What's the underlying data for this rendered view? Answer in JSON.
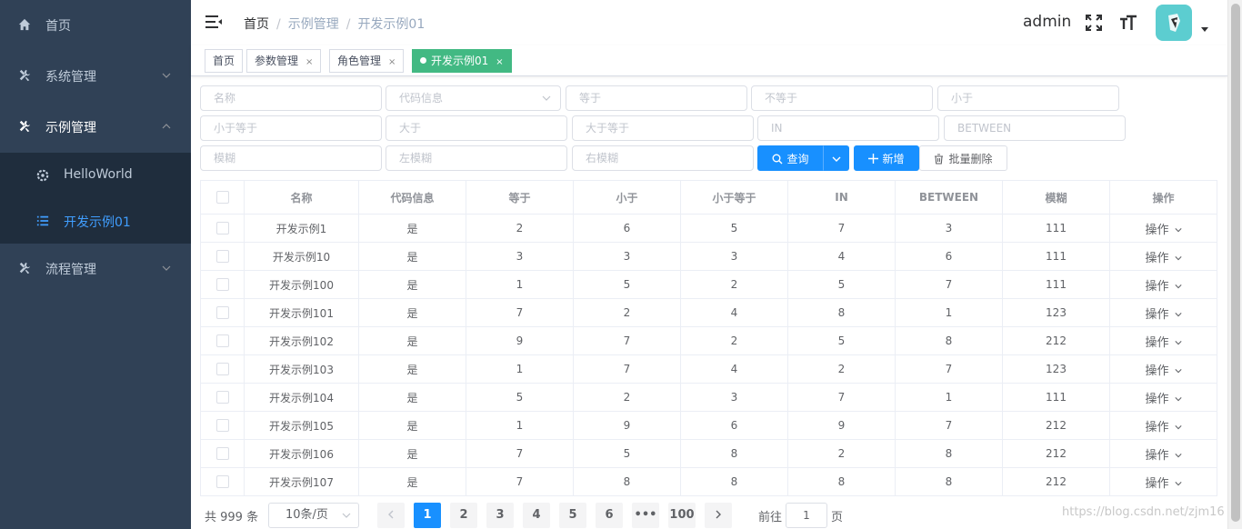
{
  "sidebar": {
    "items": [
      {
        "label": "首页",
        "icon": "home-icon"
      },
      {
        "label": "系统管理",
        "icon": "tools-icon"
      },
      {
        "label": "示例管理",
        "icon": "tools-icon"
      },
      {
        "label": "流程管理",
        "icon": "tools-icon"
      }
    ],
    "subitems": [
      {
        "label": "HelloWorld",
        "icon": "gear-icon"
      },
      {
        "label": "开发示例01",
        "icon": "list-icon"
      }
    ]
  },
  "navbar": {
    "breadcrumb": [
      "首页",
      "示例管理",
      "开发示例01"
    ],
    "breadcrumb_sep": "/",
    "username": "admin"
  },
  "tags": [
    {
      "label": "首页"
    },
    {
      "label": "参数管理",
      "close": "×"
    },
    {
      "label": "角色管理",
      "close": "×"
    },
    {
      "label": "开发示例01",
      "close": "×"
    }
  ],
  "filters": {
    "name": "名称",
    "code": "代码信息",
    "eq": "等于",
    "neq": "不等于",
    "lt": "小于",
    "lte": "小于等于",
    "gt": "大于",
    "gte": "大于等于",
    "in": "IN",
    "between": "BETWEEN",
    "like": "模糊",
    "left_like": "左模糊",
    "right_like": "右模糊"
  },
  "buttons": {
    "query": "查询",
    "add": "新增",
    "batch_delete": "批量删除"
  },
  "table": {
    "headers": [
      "名称",
      "代码信息",
      "等于",
      "小于",
      "小于等于",
      "IN",
      "BETWEEN",
      "模糊",
      "操作"
    ],
    "op_label": "操作",
    "rows": [
      [
        "开发示例1",
        "是",
        "2",
        "6",
        "5",
        "7",
        "3",
        "111"
      ],
      [
        "开发示例10",
        "是",
        "3",
        "3",
        "3",
        "4",
        "6",
        "111"
      ],
      [
        "开发示例100",
        "是",
        "1",
        "5",
        "2",
        "5",
        "7",
        "111"
      ],
      [
        "开发示例101",
        "是",
        "7",
        "2",
        "4",
        "8",
        "1",
        "123"
      ],
      [
        "开发示例102",
        "是",
        "9",
        "7",
        "2",
        "5",
        "8",
        "212"
      ],
      [
        "开发示例103",
        "是",
        "1",
        "7",
        "4",
        "2",
        "7",
        "123"
      ],
      [
        "开发示例104",
        "是",
        "5",
        "2",
        "3",
        "7",
        "1",
        "111"
      ],
      [
        "开发示例105",
        "是",
        "1",
        "9",
        "6",
        "9",
        "7",
        "212"
      ],
      [
        "开发示例106",
        "是",
        "7",
        "5",
        "8",
        "2",
        "8",
        "212"
      ],
      [
        "开发示例107",
        "是",
        "7",
        "8",
        "8",
        "8",
        "8",
        "212"
      ]
    ]
  },
  "pagination": {
    "total": "共 999 条",
    "page_size": "10条/页",
    "pages": [
      "1",
      "2",
      "3",
      "4",
      "5",
      "6",
      "•••",
      "100"
    ],
    "current": "1",
    "goto_prefix": "前往",
    "goto_value": "1",
    "goto_suffix": "页"
  },
  "watermark": "https://blog.csdn.net/zjm16",
  "colors": {
    "sidebar_bg": "#304156",
    "submenu_bg": "#1f2d3d",
    "active_menu": "#409eff",
    "active_tag": "#42b983",
    "primary": "#1890ff"
  }
}
